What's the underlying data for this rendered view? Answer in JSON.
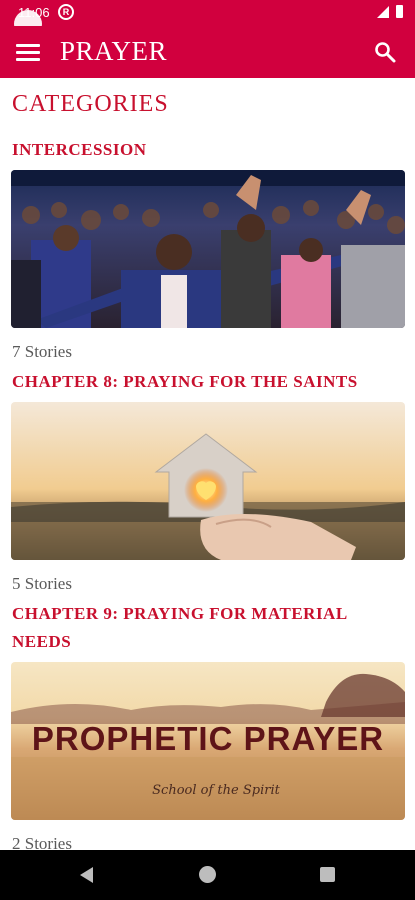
{
  "status_bar": {
    "time": "11:06",
    "notification_icon": "registered-icon"
  },
  "app_bar": {
    "title": "PRAYER",
    "menu_icon": "hamburger-menu-icon",
    "search_icon": "search-icon"
  },
  "section": {
    "title": "CATEGORIES"
  },
  "categories": [
    {
      "title": "INTERCESSION",
      "count": "7 Stories",
      "image": "crowd-worshipping-photo"
    },
    {
      "title": "CHAPTER 8: PRAYING FOR THE SAINTS",
      "count": "5 Stories",
      "image": "paper-house-heart-sunset-photo"
    },
    {
      "title": "CHAPTER 9: PRAYING FOR MATERIAL NEEDS",
      "count": "2 Stories",
      "image": "prophetic-prayer-banner",
      "image_text": "PROPHETIC PRAYER",
      "image_subtext": "School of the Spirit"
    }
  ],
  "colors": {
    "primary": "#d1003e",
    "title_red": "#c8102e",
    "count_gray": "#5a5a5a"
  },
  "nav_bar": {
    "back_icon": "back-triangle-icon",
    "home_icon": "home-circle-icon",
    "recents_icon": "recents-square-icon"
  }
}
